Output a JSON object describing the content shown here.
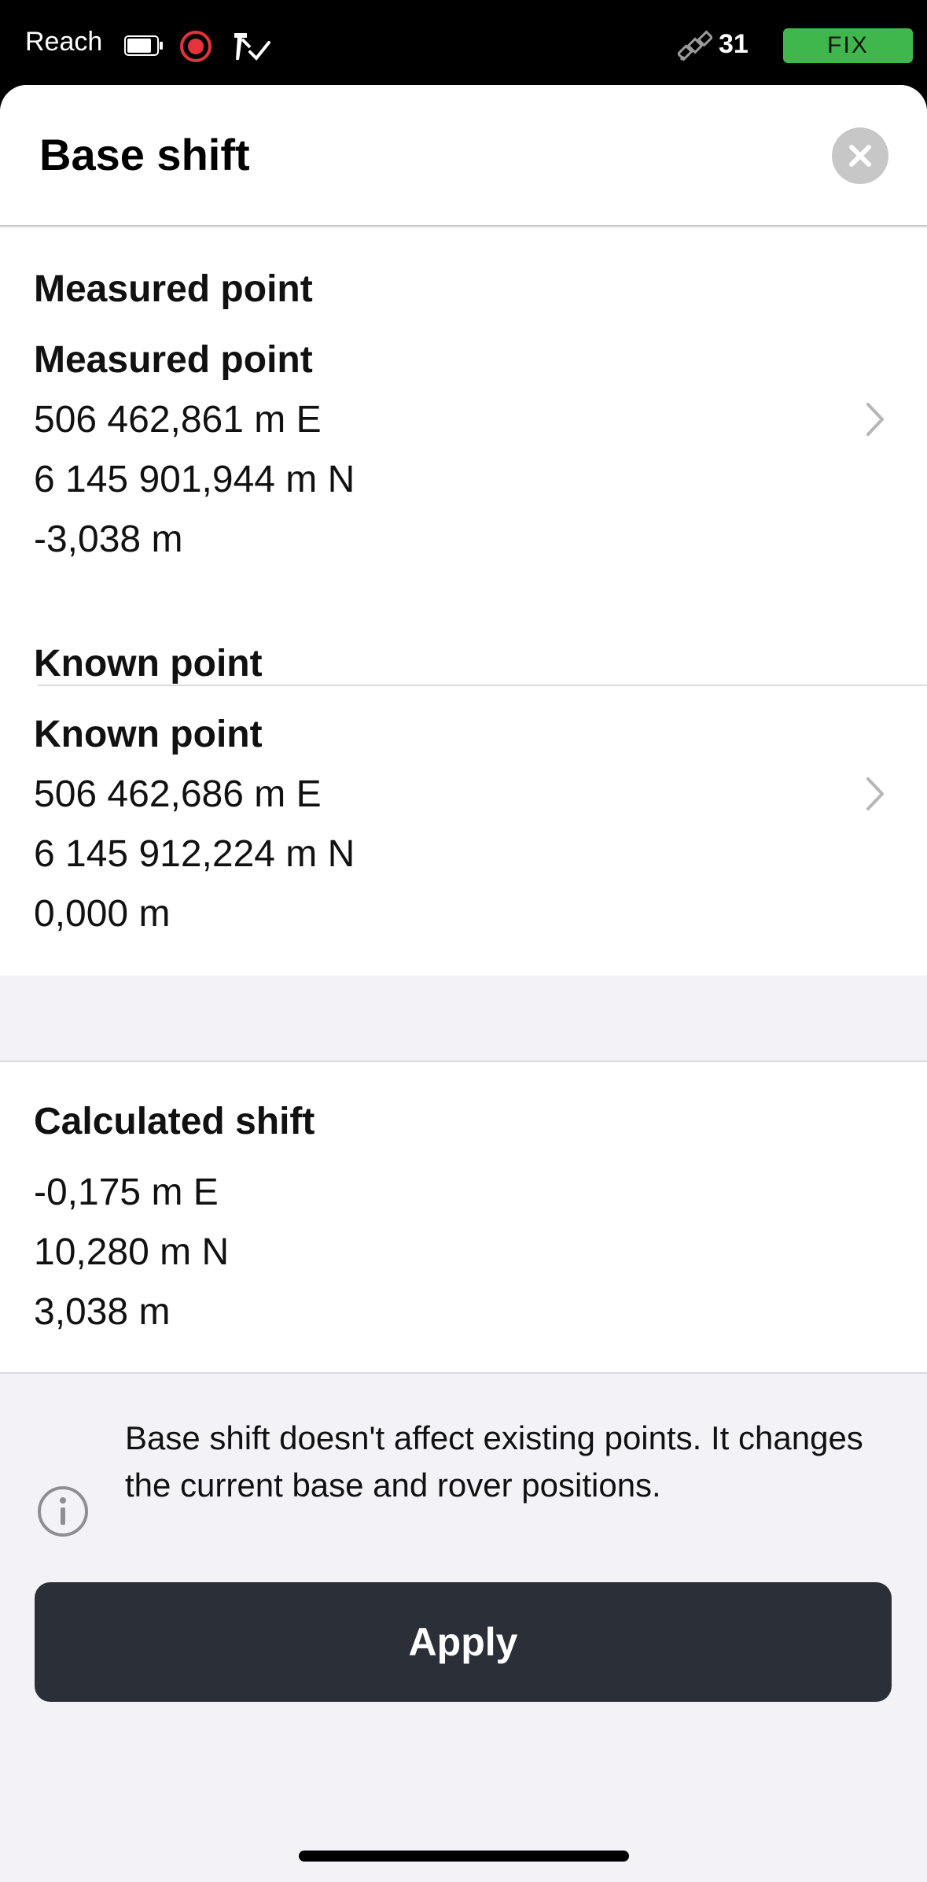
{
  "status_bar": {
    "app_name": "Reach",
    "satellite_count": "31",
    "fix_status": "FIX",
    "fix_color": "#3fb74c",
    "record_color": "#e5333b",
    "icons": [
      "battery-icon",
      "record-icon",
      "tools-check-icon",
      "satellite-icon"
    ]
  },
  "header": {
    "title": "Base shift",
    "close_icon": "close-icon"
  },
  "measured": {
    "heading": "Measured point",
    "title": "Measured point",
    "easting": "506 462,861 m E",
    "northing": "6 145 901,944 m N",
    "height": "-3,038 m"
  },
  "known": {
    "heading": "Known point",
    "title": "Known point",
    "easting": "506 462,686 m E",
    "northing": "6 145 912,224 m N",
    "height": "0,000 m"
  },
  "shift": {
    "heading": "Calculated shift",
    "easting": "-0,175 m E",
    "northing": "10,280 m N",
    "height": "3,038 m"
  },
  "info": {
    "icon": "info-icon",
    "text": "Base shift doesn't affect existing points. It changes the current base and rover positions."
  },
  "actions": {
    "apply_label": "Apply"
  }
}
